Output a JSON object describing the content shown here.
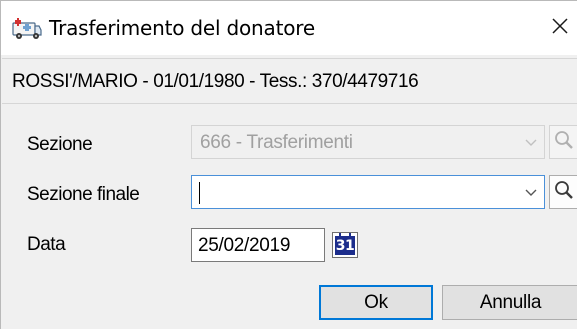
{
  "window": {
    "title": "Trasferimento del donatore",
    "icon": "ambulance-icon",
    "close_icon": "close-icon"
  },
  "donor_info": "ROSSI'/MARIO - 01/01/1980 - Tess.: 370/4479716",
  "form": {
    "sezione": {
      "label": "Sezione",
      "value": "666 -  Trasferimenti",
      "enabled": false
    },
    "sezione_finale": {
      "label": "Sezione finale",
      "value": "",
      "enabled": true
    },
    "data": {
      "label": "Data",
      "value": "25/02/2019",
      "calendar_day": "31"
    }
  },
  "buttons": {
    "ok": "Ok",
    "annulla": "Annulla"
  },
  "colors": {
    "focus_border": "#0078d7",
    "calendar_blue": "#1c2d8c",
    "disabled_text": "#a0a0a0"
  }
}
